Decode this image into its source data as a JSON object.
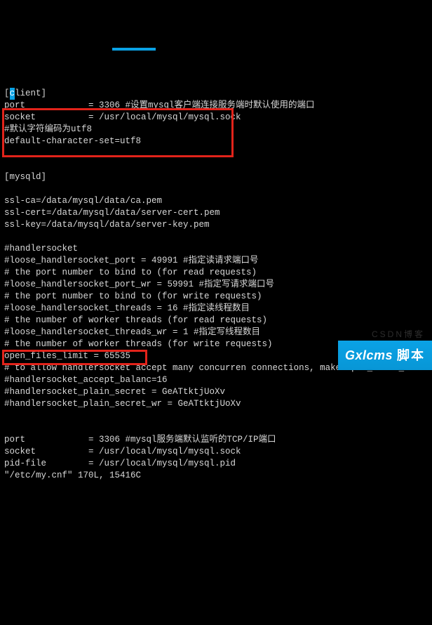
{
  "lines": {
    "l1a": "[",
    "l1b": "c",
    "l1c": "lient]",
    "l2": "port            = 3306 #设置mysql客户端连接服务端时默认使用的端口",
    "l3": "socket          = /usr/local/mysql/mysql.sock",
    "l4": "#默认字符编码为utf8",
    "l5": "default-character-set=utf8",
    "l6": "",
    "l7": "",
    "l8": "[mysqld]",
    "l9": "",
    "l10": "ssl-ca=/data/mysql/data/ca.pem",
    "l11": "ssl-cert=/data/mysql/data/server-cert.pem",
    "l12": "ssl-key=/data/mysql/data/server-key.pem",
    "l13": "",
    "l14": "#handlersocket",
    "l15": "#loose_handlersocket_port = 49991 #指定读请求端口号",
    "l16": "# the port number to bind to (for read requests)",
    "l17": "#loose_handlersocket_port_wr = 59991 #指定写请求端口号",
    "l18": "# the port number to bind to (for write requests)",
    "l19": "#loose_handlersocket_threads = 16 #指定读线程数目",
    "l20": "# the number of worker threads (for read requests)",
    "l21": "#loose_handlersocket_threads_wr = 1 #指定写线程数目",
    "l22": "# the number of worker threads (for write requests)",
    "l23": "open_files_limit = 65535",
    "l24": "# to allow handlersocket accept many concurren connections, make open_files_limit as la",
    "l25": "#handlersocket_accept_balanc=16",
    "l26": "#handlersocket_plain_secret = GeATtktjUoXv",
    "l27": "#handlersocket_plain_secret_wr = GeATtktjUoXv",
    "l28": "",
    "l29": "",
    "l30": "port            = 3306 #mysql服务端默认监听的TCP/IP端口",
    "l31": "socket          = /usr/local/mysql/mysql.sock",
    "l32": "pid-file        = /usr/local/mysql/mysql.pid",
    "l33": "\"/etc/my.cnf\" 170L, 15416C"
  },
  "watermark": {
    "brand": "Gxlcms",
    "script": "脚本"
  },
  "faded": "CSDN博客"
}
